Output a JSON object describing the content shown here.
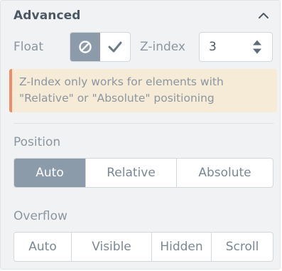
{
  "section": {
    "title": "Advanced",
    "collapse_icon": "chevron-up-icon"
  },
  "float": {
    "label": "Float",
    "options": [
      {
        "icon": "no-float-icon",
        "active": true
      },
      {
        "icon": "checkmark-icon",
        "active": false
      }
    ]
  },
  "zindex": {
    "label": "Z-index",
    "value": "3"
  },
  "notice": {
    "line1": "Z-Index only works for elements with",
    "line2": "\"Relative\" or \"Absolute\" positioning"
  },
  "position": {
    "label": "Position",
    "options": [
      "Auto",
      "Relative",
      "Absolute"
    ],
    "selected": "Auto"
  },
  "overflow": {
    "label": "Overflow",
    "options": [
      "Auto",
      "Visible",
      "Hidden",
      "Scroll"
    ],
    "selected": null
  },
  "colors": {
    "accent": "#8c9baa",
    "notice_bg": "#f5ebd6",
    "notice_border": "#f28c66"
  }
}
